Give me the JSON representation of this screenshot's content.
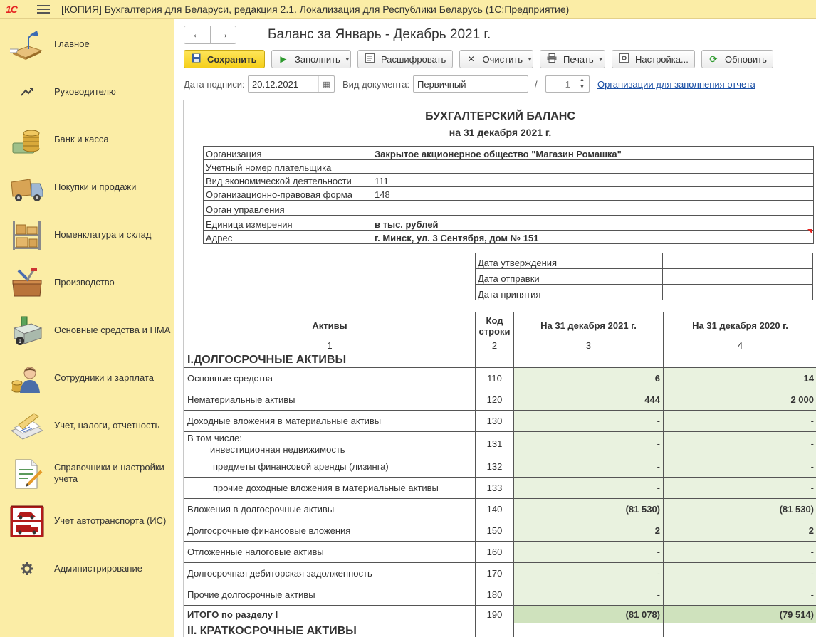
{
  "app": {
    "logo": "1С",
    "title": "[КОПИЯ] Бухгалтерия для Беларуси, редакция 2.1. Локализация для Республики Беларусь   (1С:Предприятие)"
  },
  "sidebar": {
    "items": [
      {
        "label": "Главное",
        "icon": "desk-lamp-icon"
      },
      {
        "label": "Руководителю",
        "icon": "trend-chart-icon"
      },
      {
        "label": "Банк и касса",
        "icon": "coins-icon"
      },
      {
        "label": "Покупки и продажи",
        "icon": "truck-icon"
      },
      {
        "label": "Номенклатура и склад",
        "icon": "warehouse-shelf-icon"
      },
      {
        "label": "Производство",
        "icon": "toolbox-icon"
      },
      {
        "label": "Основные средства и НМА",
        "icon": "building-icon"
      },
      {
        "label": "Сотрудники и зарплата",
        "icon": "employee-icon"
      },
      {
        "label": "Учет, налоги, отчетность",
        "icon": "documents-icon"
      },
      {
        "label": "Справочники и настройки учета",
        "icon": "document-pencil-icon"
      },
      {
        "label": "Учет автотранспорта (ИС)",
        "icon": "vehicles-icon"
      },
      {
        "label": "Администрирование",
        "icon": "gear-icon"
      }
    ]
  },
  "header": {
    "back": "←",
    "forward": "→",
    "title": "Баланс за Январь - Декабрь 2021 г."
  },
  "toolbar": {
    "save": "Сохранить",
    "fill": "Заполнить",
    "decode": "Расшифровать",
    "clear": "Очистить",
    "print": "Печать",
    "settings": "Настройка...",
    "refresh": "Обновить"
  },
  "form": {
    "sign_date_label": "Дата подписи:",
    "sign_date": "20.12.2021",
    "doc_kind_label": "Вид документа:",
    "doc_kind": "Первичный",
    "slash": "/",
    "correction_num": "1",
    "orgs_link": "Организации для заполнения отчета"
  },
  "report": {
    "title": "БУХГАЛТЕРСКИЙ БАЛАНС",
    "subtitle": "на 31 декабря 2021 г.",
    "info": [
      {
        "key": "Организация",
        "value": "Закрытое акционерное общество \"Магазин Ромашка\"",
        "bold": true
      },
      {
        "key": "Учетный номер плательщика",
        "value": "",
        "bold": false
      },
      {
        "key": "Вид экономической деятельности",
        "value": "111",
        "bold": false
      },
      {
        "key": "Организационно-правовая форма",
        "value": "148",
        "bold": false
      },
      {
        "key": "Орган управления",
        "value": "",
        "bold": false
      },
      {
        "key": "Единица измерения",
        "value": "в тыс. рублей",
        "bold": true
      },
      {
        "key": "Адрес",
        "value": "г. Минск, ул. 3 Сентября, дом № 151",
        "bold": true
      }
    ],
    "dates": [
      {
        "key": "Дата утверждения",
        "value": ""
      },
      {
        "key": "Дата отправки",
        "value": ""
      },
      {
        "key": "Дата принятия",
        "value": ""
      }
    ],
    "columns": {
      "assets": "Активы",
      "code_1": "Код",
      "code_2": "строки",
      "y2021": "На 31 декабря 2021 г.",
      "y2020": "На 31 декабря 2020 г.",
      "n1": "1",
      "n2": "2",
      "n3": "3",
      "n4": "4"
    },
    "section1": "I.ДОЛГОСРОЧНЫЕ АКТИВЫ",
    "rows": [
      {
        "name": "Основные средства",
        "code": "110",
        "v2021": "6",
        "v2020": "14"
      },
      {
        "name": "Нематериальные активы",
        "code": "120",
        "v2021": "444",
        "v2020": "2 000"
      },
      {
        "name": "Доходные вложения в материальные активы",
        "code": "130",
        "v2021": "-",
        "v2020": "-"
      },
      {
        "name_top": "В том числе:",
        "name": "инвестиционная недвижимость",
        "code": "131",
        "v2021": "-",
        "v2020": "-"
      },
      {
        "name": "предметы финансовой аренды (лизинга)",
        "code": "132",
        "v2021": "-",
        "v2020": "-"
      },
      {
        "name": "прочие доходные вложения в материальные активы",
        "code": "133",
        "v2021": "-",
        "v2020": "-"
      },
      {
        "name": "Вложения в долгосрочные активы",
        "code": "140",
        "v2021": "(81 530)",
        "v2020": "(81 530)"
      },
      {
        "name": "Долгосрочные финансовые вложения",
        "code": "150",
        "v2021": "2",
        "v2020": "2"
      },
      {
        "name": "Отложенные налоговые активы",
        "code": "160",
        "v2021": "-",
        "v2020": "-"
      },
      {
        "name": "Долгосрочная дебиторская задолженность",
        "code": "170",
        "v2021": "-",
        "v2020": "-"
      },
      {
        "name": "Прочие долгосрочные активы",
        "code": "180",
        "v2021": "-",
        "v2020": "-"
      }
    ],
    "total": {
      "name": "ИТОГО по разделу I",
      "code": "190",
      "v2021": "(81 078)",
      "v2020": "(79 514)"
    },
    "section2": "II. КРАТКОСРОЧНЫЕ АКТИВЫ"
  },
  "colors": {
    "sidebar_bg": "#fbeda6",
    "value_cell_bg": "#e9f2df",
    "total_cell_bg": "#cfe2bd",
    "save_button": "#f5cf1a",
    "link": "#1a4fa5"
  }
}
